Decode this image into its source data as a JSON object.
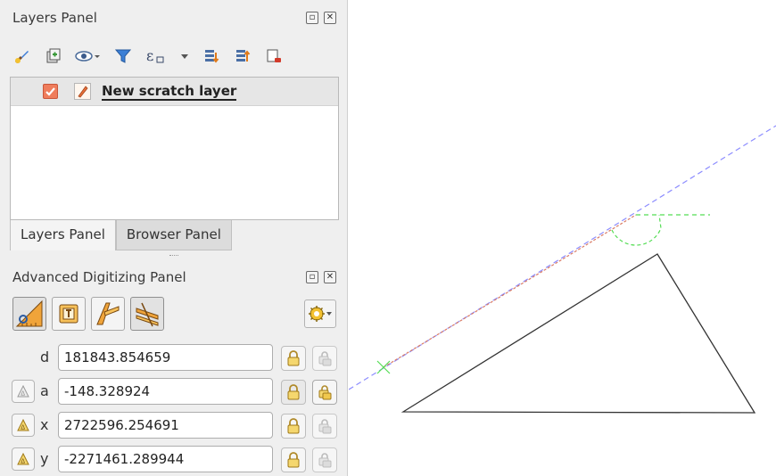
{
  "layers_panel": {
    "title": "Layers Panel",
    "layers": [
      {
        "name": "New scratch layer",
        "checked": true,
        "editing": true
      }
    ],
    "tabs": [
      {
        "label": "Layers Panel",
        "active": true
      },
      {
        "label": "Browser Panel",
        "active": false
      }
    ],
    "toolbar_icons": [
      "style-brush-icon",
      "add-group-icon",
      "visibility-eye-icon",
      "filter-icon",
      "expression-filter-icon",
      "dropdown-arrow-icon",
      "expand-all-icon",
      "collapse-all-icon",
      "remove-layer-icon"
    ]
  },
  "advanced_digitizing": {
    "title": "Advanced Digitizing Panel",
    "tool_icons": [
      "construction-mode-icon",
      "parallel-perpendicular-icon",
      "parallel-icon",
      "snapping-settings-icon"
    ],
    "fields": [
      {
        "key": "d",
        "label": "d",
        "value": "181843.854659",
        "has_relative_toggle": false
      },
      {
        "key": "a",
        "label": "a",
        "value": "-148.328924",
        "has_relative_toggle": true
      },
      {
        "key": "x",
        "label": "x",
        "value": "2722596.254691",
        "has_relative_toggle": true
      },
      {
        "key": "y",
        "label": "y",
        "value": "-2271461.289944",
        "has_relative_toggle": true
      }
    ]
  },
  "colors": {
    "accent_orange": "#ef7d5c",
    "guide_blue": "#8c8cff",
    "guide_green": "#55dd55",
    "segment_red": "#d97a64",
    "triangle": "#333333"
  }
}
